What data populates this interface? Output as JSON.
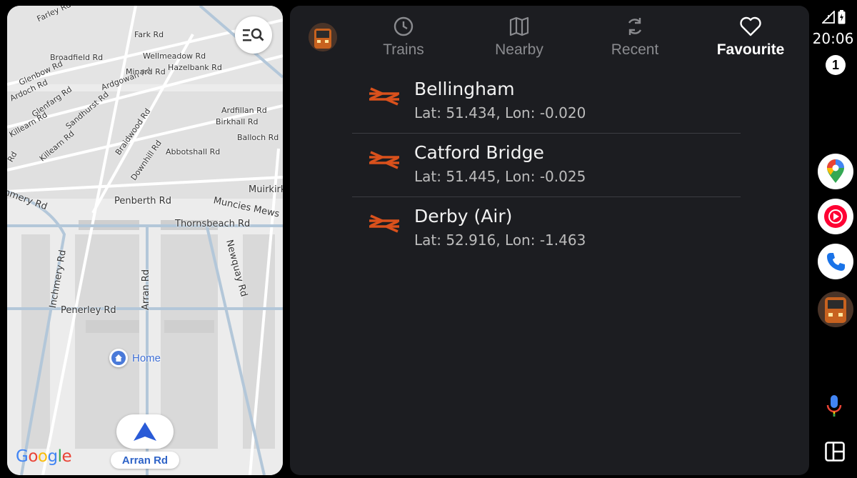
{
  "map": {
    "google_logo": [
      "G",
      "o",
      "o",
      "g",
      "l",
      "e"
    ],
    "google_colors": [
      "#4285F4",
      "#EA4335",
      "#FBBC05",
      "#4285F4",
      "#34A853",
      "#EA4335"
    ],
    "home_label": "Home",
    "current_road": "Arran Rd",
    "search_icon": "search-list-icon",
    "streets": [
      "Penberth Rd",
      "Thornsbeach Rd",
      "Muirkirk",
      "Muncies Mews",
      "Penerley Rd",
      "Arran Rd",
      "Newquay Rd",
      "Inchmery Rd",
      "nmery Rd",
      "Abbotshall Rd",
      "Balloch Rd",
      "Birkhall Rd",
      "Ardfillan Rd",
      "Downhill Rd",
      "Braidwood Rd",
      "Killearn Rd",
      "Sandhurst Rd",
      "Glenfarg Rd",
      "Ardgowan Rd",
      "Minard Rd",
      "Wellmeadow Rd",
      "Broadfield Rd",
      "Fark Rd",
      "Hazelbank Rd",
      "Ardoch Rd",
      "Killearn Rd",
      "Glenbow Rd",
      "Farley Rd",
      "Rd"
    ]
  },
  "app": {
    "icon": "train-app-icon",
    "tabs": [
      {
        "label": "Trains",
        "icon": "clock-icon",
        "active": false
      },
      {
        "label": "Nearby",
        "icon": "map-icon",
        "active": false
      },
      {
        "label": "Recent",
        "icon": "refresh-icon",
        "active": false
      },
      {
        "label": "Favourite",
        "icon": "heart-icon",
        "active": true
      }
    ],
    "stations": [
      {
        "name": "Bellingham",
        "coords": "Lat: 51.434, Lon: -0.020"
      },
      {
        "name": "Catford Bridge",
        "coords": "Lat: 51.445, Lon: -0.025"
      },
      {
        "name": "Derby (Air)",
        "coords": "Lat: 52.916, Lon: -1.463"
      }
    ],
    "rail_logo_color": "#d9511c"
  },
  "status": {
    "time": "20:06",
    "notification_count": "1",
    "icons": [
      "signal-icon",
      "battery-icon"
    ]
  },
  "rail": {
    "apps": [
      "google-maps-icon",
      "youtube-music-icon",
      "phone-icon",
      "train-app-icon"
    ],
    "bottom": [
      "microphone-icon",
      "layout-icon"
    ]
  }
}
